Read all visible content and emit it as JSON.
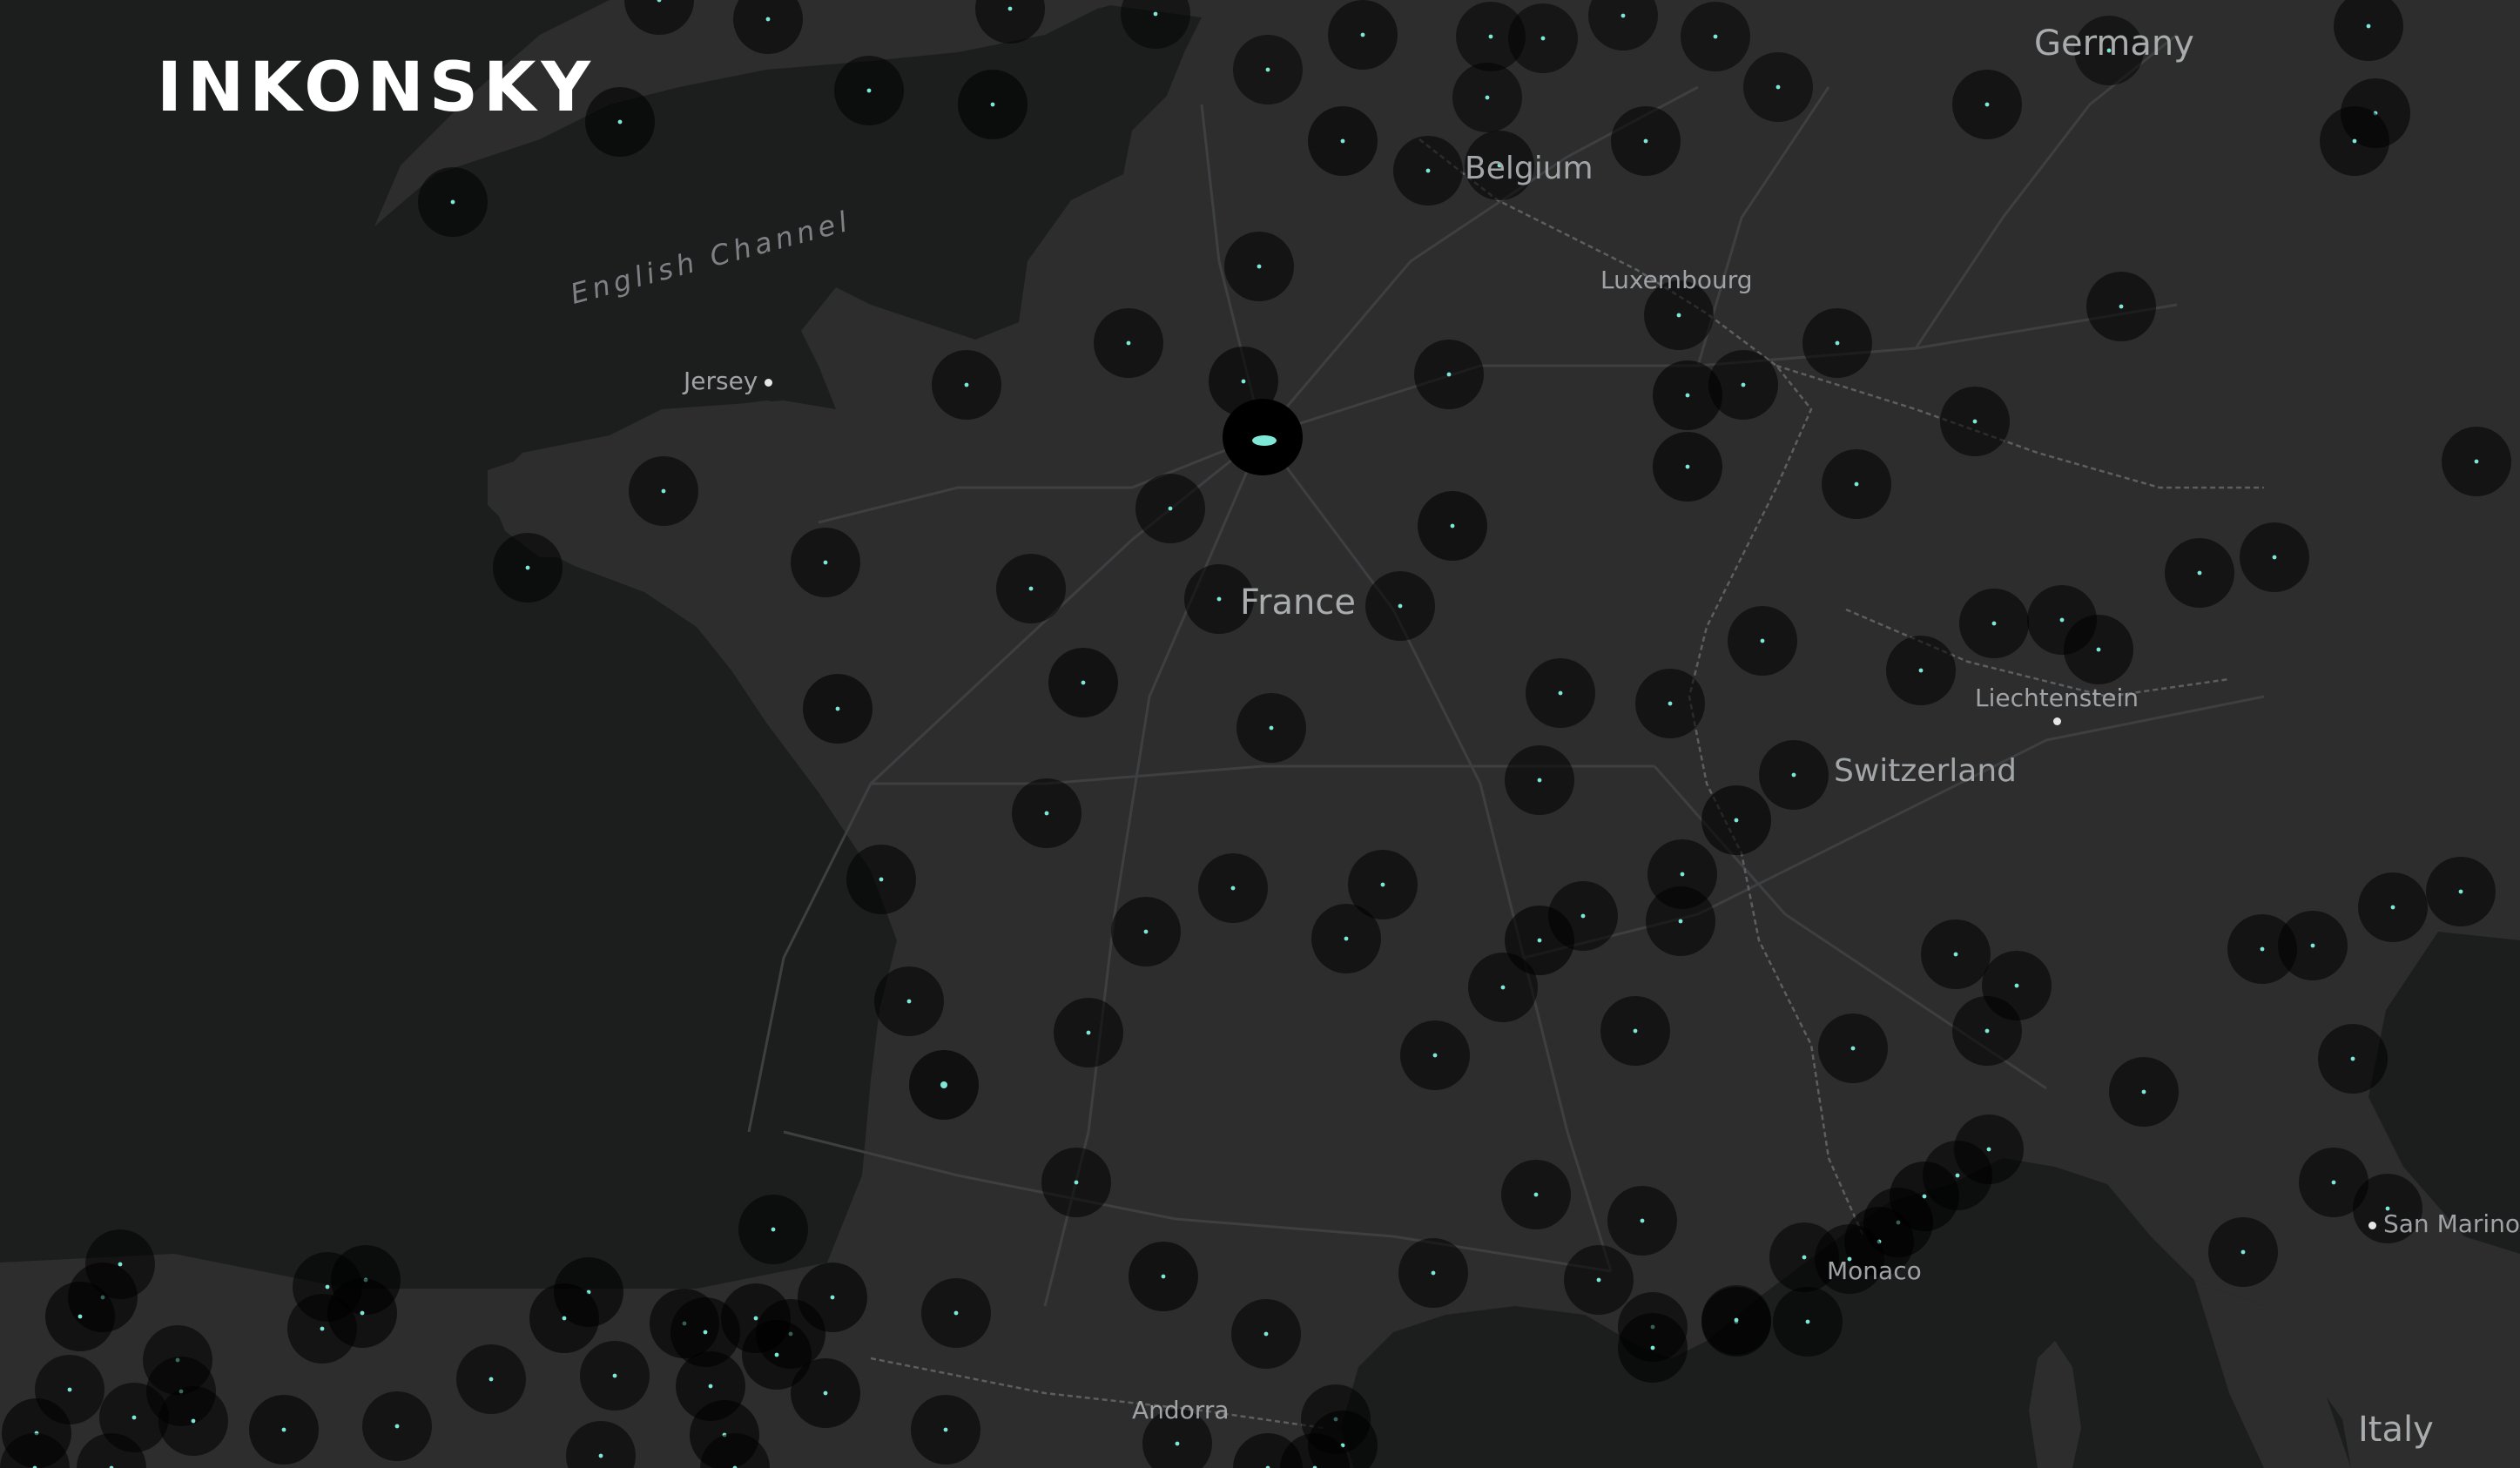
{
  "brand": {
    "name": "INKONSKY"
  },
  "map": {
    "labels": {
      "germany": "Germany",
      "belgium": "Belgium",
      "luxembourg": "Luxembourg",
      "english_channel": "English Channel",
      "jersey": "Jersey",
      "france": "France",
      "liechtenstein": "Liechtenstein",
      "switzerland": "Switzerland",
      "monaco": "Monaco",
      "san_marino": "San Marino",
      "andorra": "Andorra",
      "italy": "Italy"
    }
  },
  "colors": {
    "sea": "#1c1e1e",
    "land": "#2d2d2e",
    "road": "#3c3d3f",
    "border": "#5a5b5d",
    "marker": "#000000",
    "marker_dot": "#7fe7d6"
  },
  "icons": {
    "marker": "location-circle-icon",
    "city": "city-dot-icon"
  }
}
